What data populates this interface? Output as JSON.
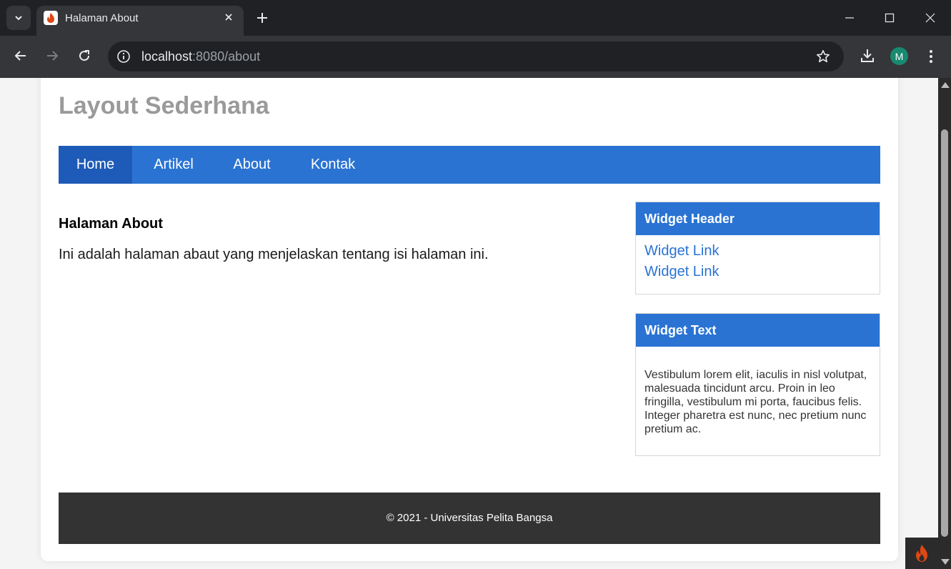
{
  "browser": {
    "tab_title": "Halaman About",
    "url_host": "localhost",
    "url_path": ":8080/about",
    "profile_initial": "M"
  },
  "site": {
    "title": "Layout Sederhana",
    "nav": [
      {
        "label": "Home",
        "active": true
      },
      {
        "label": "Artikel"
      },
      {
        "label": "About"
      },
      {
        "label": "Kontak"
      }
    ]
  },
  "content": {
    "heading": "Halaman About",
    "paragraph": "Ini adalah halaman abaut yang menjelaskan tentang isi halaman ini."
  },
  "sidebar": {
    "widget1": {
      "header": "Widget Header",
      "links": [
        "Widget Link",
        "Widget Link"
      ]
    },
    "widget2": {
      "header": "Widget Text",
      "text": "Vestibulum lorem elit, iaculis in nisl volutpat, malesuada tincidunt arcu. Proin in leo fringilla, vestibulum mi porta, faucibus felis. Integer pharetra est nunc, nec pretium nunc pretium ac."
    }
  },
  "footer": {
    "text": "© 2021 - Universitas Pelita Bangsa"
  },
  "colors": {
    "accent": "#2a73d3",
    "accent_active": "#1e5bb8",
    "footer_bg": "#333333",
    "title_gray": "#9a9a9a"
  },
  "icons": [
    "tab-search-icon",
    "favicon-flame-icon",
    "close-tab-icon",
    "new-tab-icon",
    "minimize-icon",
    "maximize-icon",
    "close-window-icon",
    "back-icon",
    "forward-icon",
    "reload-icon",
    "site-info-icon",
    "bookmark-star-icon",
    "download-icon",
    "menu-kebab-icon",
    "codeigniter-flame-icon"
  ]
}
